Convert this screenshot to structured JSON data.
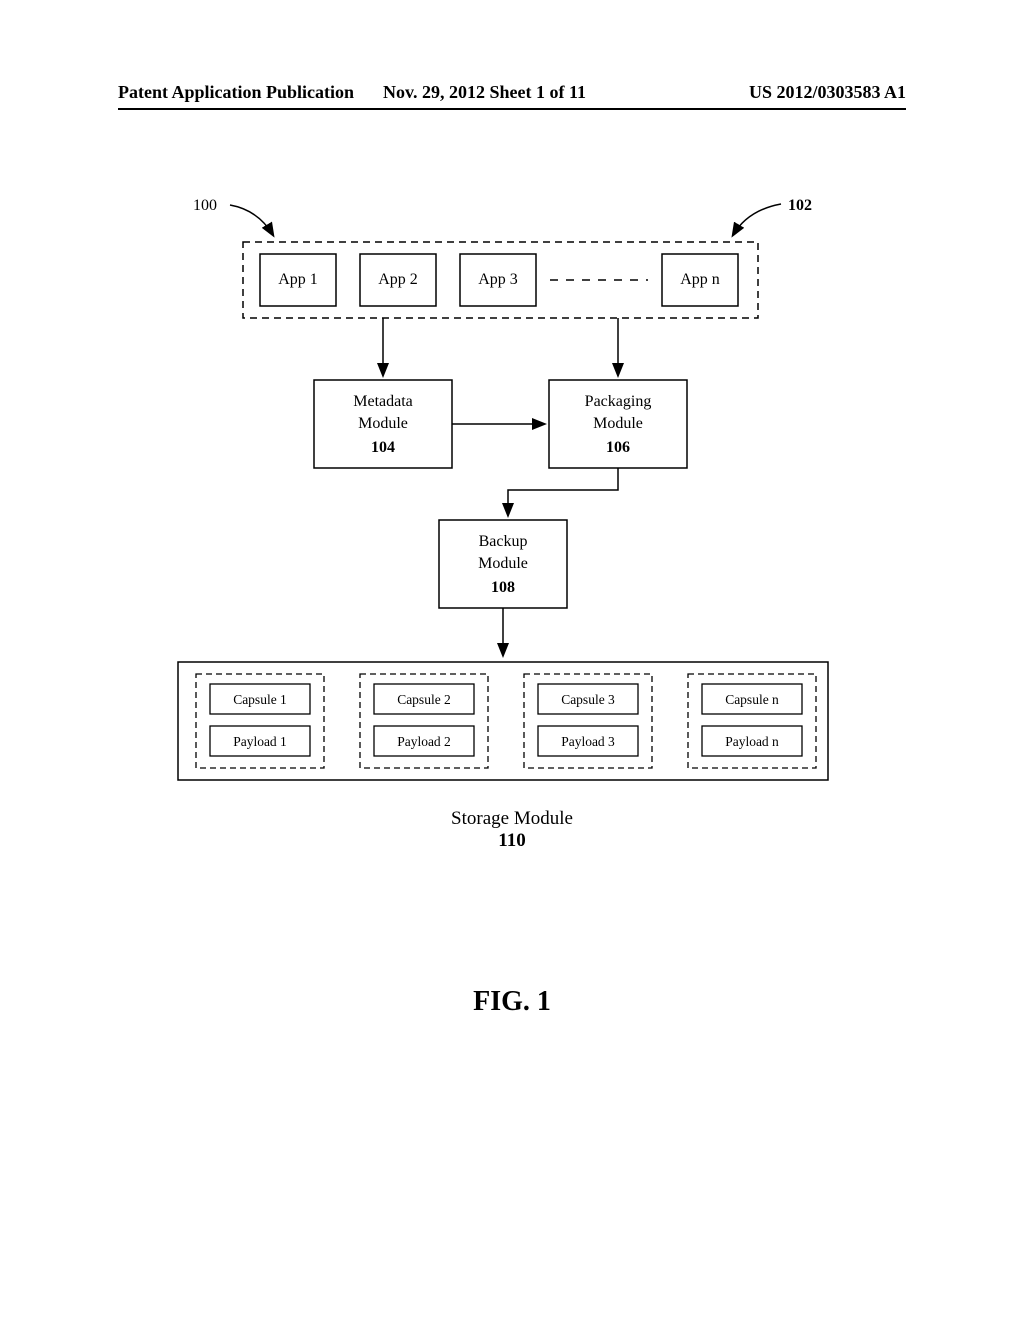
{
  "header": {
    "left": "Patent Application Publication",
    "mid": "Nov. 29, 2012  Sheet 1 of 11",
    "right": "US 2012/0303583 A1"
  },
  "refs": {
    "r100": "100",
    "r102": "102",
    "r104": "104",
    "r106": "106",
    "r108": "108",
    "r110": "110"
  },
  "apps": {
    "a1": "App 1",
    "a2": "App 2",
    "a3": "App 3",
    "an": "App n"
  },
  "modules": {
    "metadata_l1": "Metadata",
    "metadata_l2": "Module",
    "packaging_l1": "Packaging",
    "packaging_l2": "Module",
    "backup_l1": "Backup",
    "backup_l2": "Module"
  },
  "capsules": {
    "c1": "Capsule 1",
    "c2": "Capsule 2",
    "c3": "Capsule 3",
    "cn": "Capsule n",
    "p1": "Payload 1",
    "p2": "Payload 2",
    "p3": "Payload 3",
    "pn": "Payload n"
  },
  "storage_label": "Storage Module",
  "fig_label": "FIG. 1"
}
